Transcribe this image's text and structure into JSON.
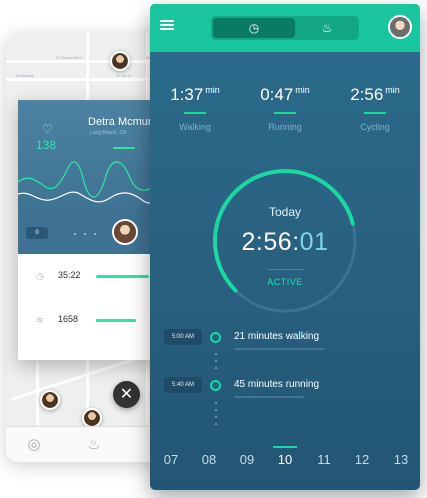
{
  "back_screen": {
    "streets": [
      "W Ocean Blvd",
      "W Ocean Blvd",
      "Broadway",
      "W 1st St"
    ]
  },
  "profile_card": {
    "name": "Detra Mcmur",
    "location": "Long Beach, CA",
    "likes": "138",
    "chip_value": "0",
    "stats": [
      {
        "icon": "clock-icon",
        "value": "35:22",
        "fill": 0.85
      },
      {
        "icon": "distance-icon",
        "value": "1658",
        "fill": 0.65
      }
    ]
  },
  "activity_screen": {
    "toggle": [
      {
        "icon": "clock-icon",
        "glyph": "◷",
        "selected": true
      },
      {
        "icon": "flame-icon",
        "glyph": "♨",
        "selected": false
      }
    ],
    "metrics": [
      {
        "value": "1:37",
        "unit": "min",
        "label": "Walking"
      },
      {
        "value": "0:47",
        "unit": "min",
        "label": "Running"
      },
      {
        "value": "2:56",
        "unit": "min",
        "label": "Cycling"
      }
    ],
    "summary": {
      "label": "Today",
      "time_main": "2:56:",
      "time_seconds": "01",
      "status": "ACTIVE",
      "progress": 0.78
    },
    "timeline": [
      {
        "time": "5:00 AM",
        "text": "21 minutes walking"
      },
      {
        "time": "5:40 AM",
        "text": "45 minutes running"
      }
    ],
    "days": [
      "07",
      "08",
      "09",
      "10",
      "11",
      "12",
      "13"
    ],
    "selected_day": "10"
  },
  "colors": {
    "accent": "#19d9a3",
    "topbar": "#19c6a0",
    "panel": "#2a6282"
  }
}
